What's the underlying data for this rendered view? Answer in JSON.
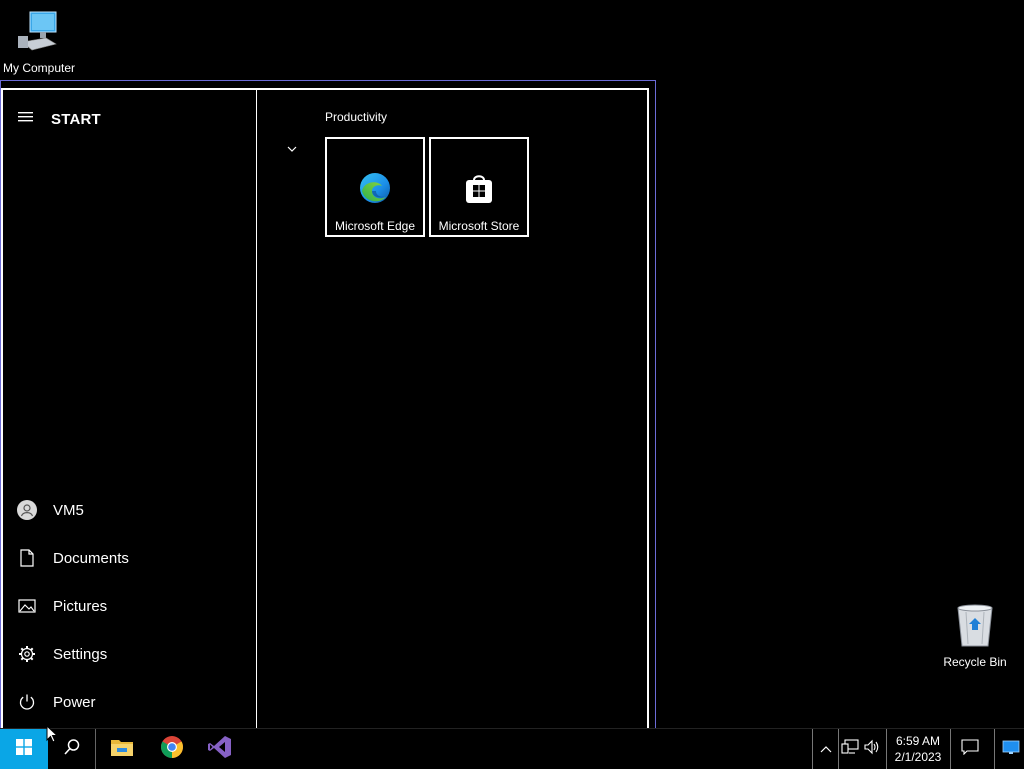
{
  "desktop": {
    "icons": [
      {
        "label": "My Computer",
        "icon": "computer-icon"
      },
      {
        "label": "Recycle Bin",
        "icon": "recycle-bin-icon"
      }
    ]
  },
  "start_menu": {
    "title": "START",
    "user": "VM5",
    "nav_items": [
      {
        "label": "Documents",
        "icon": "document-icon"
      },
      {
        "label": "Pictures",
        "icon": "pictures-icon"
      },
      {
        "label": "Settings",
        "icon": "gear-icon"
      },
      {
        "label": "Power",
        "icon": "power-icon"
      }
    ],
    "group": {
      "title": "Productivity",
      "tiles": [
        {
          "label": "Microsoft Edge",
          "icon": "edge-icon"
        },
        {
          "label": "Microsoft Store",
          "icon": "store-icon"
        }
      ]
    }
  },
  "taskbar": {
    "pinned": [
      "file-explorer-icon",
      "chrome-icon",
      "visual-studio-icon"
    ],
    "clock": {
      "time": "6:59 AM",
      "date": "2/1/2023"
    }
  },
  "colors": {
    "start_button": "#0aa6e6",
    "frame_accent": "#6b6bd6"
  }
}
